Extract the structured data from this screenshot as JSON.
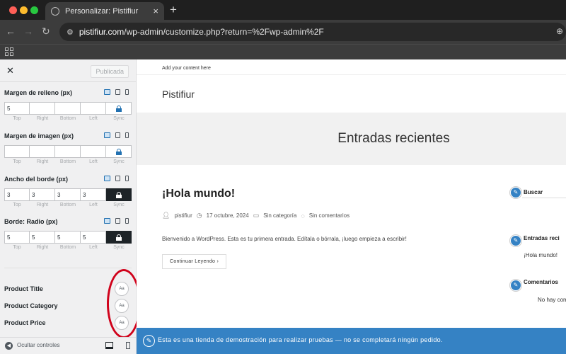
{
  "browser": {
    "tab_title": "Personalizar: Pistifiur",
    "url_host": "pistifiur.com",
    "url_path": "/wp-admin/customize.php?return=%2Fwp-admin%2F"
  },
  "panel": {
    "publish_label": "Publicada",
    "controls": [
      {
        "label": "Margen de relleno (px)",
        "values": [
          "5",
          "",
          "",
          ""
        ],
        "sync_locked": false
      },
      {
        "label": "Margen de imagen (px)",
        "values": [
          "",
          "",
          "",
          ""
        ],
        "sync_locked": false
      },
      {
        "label": "Ancho del borde (px)",
        "values": [
          "3",
          "3",
          "3",
          "3"
        ],
        "sync_locked": true
      },
      {
        "label": "Borde: Radio (px)",
        "values": [
          "5",
          "5",
          "5",
          "5"
        ],
        "sync_locked": true
      }
    ],
    "sublabels": [
      "Top",
      "Right",
      "Bottom",
      "Left",
      "Sync"
    ],
    "typography": [
      {
        "label": "Product Title",
        "button": "Aa"
      },
      {
        "label": "Product Category",
        "button": "Aa"
      },
      {
        "label": "Product Price",
        "button": "Aa"
      }
    ],
    "footer_label": "Ocultar controles"
  },
  "preview": {
    "topbar_text": "Add your content here",
    "site_title": "Pistifiur",
    "hero_title": "Entradas recientes",
    "post": {
      "title": "¡Hola mundo!",
      "author": "pistifiur",
      "date": "17 octubre, 2024",
      "category": "Sin categoría",
      "comments": "Sin comentarios",
      "excerpt": "Bienvenido a WordPress. Esta es tu primera entrada. Edítala o bórrala, ¡luego empieza a escribir!",
      "read_more": "Continuar Leyendo"
    },
    "sidebar": {
      "search_title": "Buscar",
      "recent_title": "Entradas reci",
      "recent_item": "¡Hola mundo!",
      "comments_title": "Comentarios",
      "comments_text": "No hay com"
    },
    "store_notice": "Esta es una tienda de demostración para realizar pruebas — no se completará ningún pedido."
  },
  "colors": {
    "accent": "#3582c4",
    "highlight": "#d0021b",
    "chrome": "#3c3c3c"
  }
}
